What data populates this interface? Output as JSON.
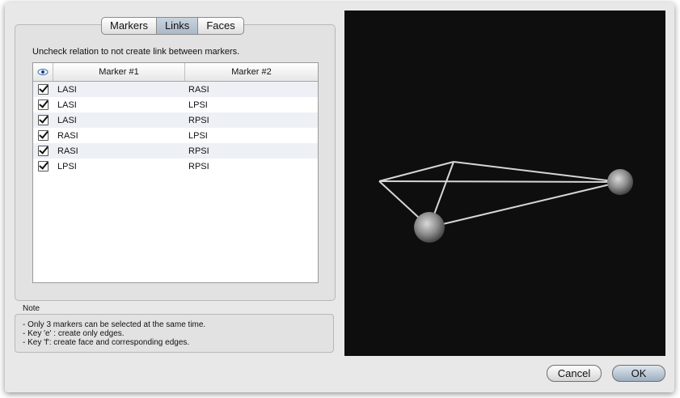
{
  "tabs": [
    {
      "label": "Markers",
      "selected": false
    },
    {
      "label": "Links",
      "selected": true
    },
    {
      "label": "Faces",
      "selected": false
    }
  ],
  "instruction": "Uncheck relation to not create link between markers.",
  "table": {
    "columns": [
      "Marker #1",
      "Marker #2"
    ],
    "visibility_icon": "eye-icon",
    "rows": [
      {
        "checked": true,
        "marker1": "LASI",
        "marker2": "RASI"
      },
      {
        "checked": true,
        "marker1": "LASI",
        "marker2": "LPSI"
      },
      {
        "checked": true,
        "marker1": "LASI",
        "marker2": "RPSI"
      },
      {
        "checked": true,
        "marker1": "RASI",
        "marker2": "LPSI"
      },
      {
        "checked": true,
        "marker1": "RASI",
        "marker2": "RPSI"
      },
      {
        "checked": true,
        "marker1": "LPSI",
        "marker2": "RPSI"
      }
    ]
  },
  "note": {
    "label": "Note",
    "lines": [
      "- Only 3 markers can be selected at the same time.",
      "- Key 'e' : create only edges.",
      "- Key 'f': create face and corresponding edges."
    ]
  },
  "buttons": {
    "cancel": "Cancel",
    "ok": "OK"
  },
  "colors": {
    "viewport_bg": "#0e0e0e",
    "link_line": "#d6d6d6",
    "selected_tab": "#b4c2d0"
  }
}
